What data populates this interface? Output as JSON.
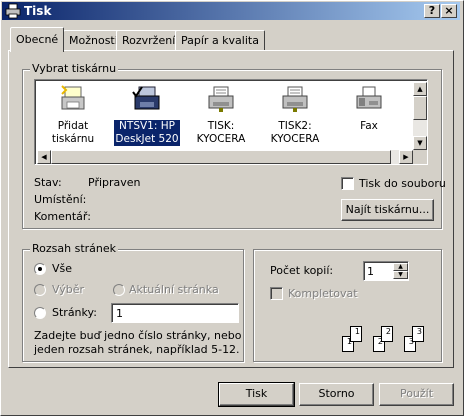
{
  "window": {
    "title": "Tisk",
    "help_button": "?",
    "close_button": "×"
  },
  "tabs": [
    {
      "label": "Obecné"
    },
    {
      "label": "Možnosti"
    },
    {
      "label": "Rozvržení"
    },
    {
      "label": "Papír a kvalita"
    }
  ],
  "printer_group": {
    "label": "Vybrat tiskárnu",
    "printers": [
      {
        "label": "Přidat tiskárnu",
        "icon": "add-printer-icon"
      },
      {
        "label_line1": "NTSV1: HP",
        "label_line2": "DeskJet 520",
        "icon": "network-printer-icon",
        "selected": true
      },
      {
        "label_line1": "TISK:",
        "label_line2": "KYOCERA",
        "icon": "printer-icon"
      },
      {
        "label_line1": "TISK2:",
        "label_line2": "KYOCERA",
        "icon": "printer-icon"
      },
      {
        "label": "Fax",
        "icon": "fax-icon"
      }
    ],
    "status_label": "Stav:",
    "status_value": "Připraven",
    "location_label": "Umístění:",
    "comment_label": "Komentář:",
    "print_to_file": "Tisk do souboru",
    "print_to_file_ul": "d",
    "find_printer": "Najít tiskárnu..."
  },
  "range_group": {
    "label": "Rozsah stránek",
    "all": "Vše",
    "selection": "Výběr",
    "current_page": "Aktuální stránka",
    "pages": "Stránky:",
    "pages_value": "1",
    "hint_line1": "Zadejte buď jedno číslo stránky, nebo",
    "hint_line2": "jeden rozsah stránek, například 5-12."
  },
  "copies_group": {
    "copies_label": "Počet kopií:",
    "copies_value": "1",
    "collate": "Kompletovat",
    "collate_pages": [
      "1",
      "1",
      "2",
      "2",
      "3",
      "3"
    ]
  },
  "footer": {
    "print": "Tisk",
    "cancel": "Storno",
    "apply": "Použít"
  }
}
